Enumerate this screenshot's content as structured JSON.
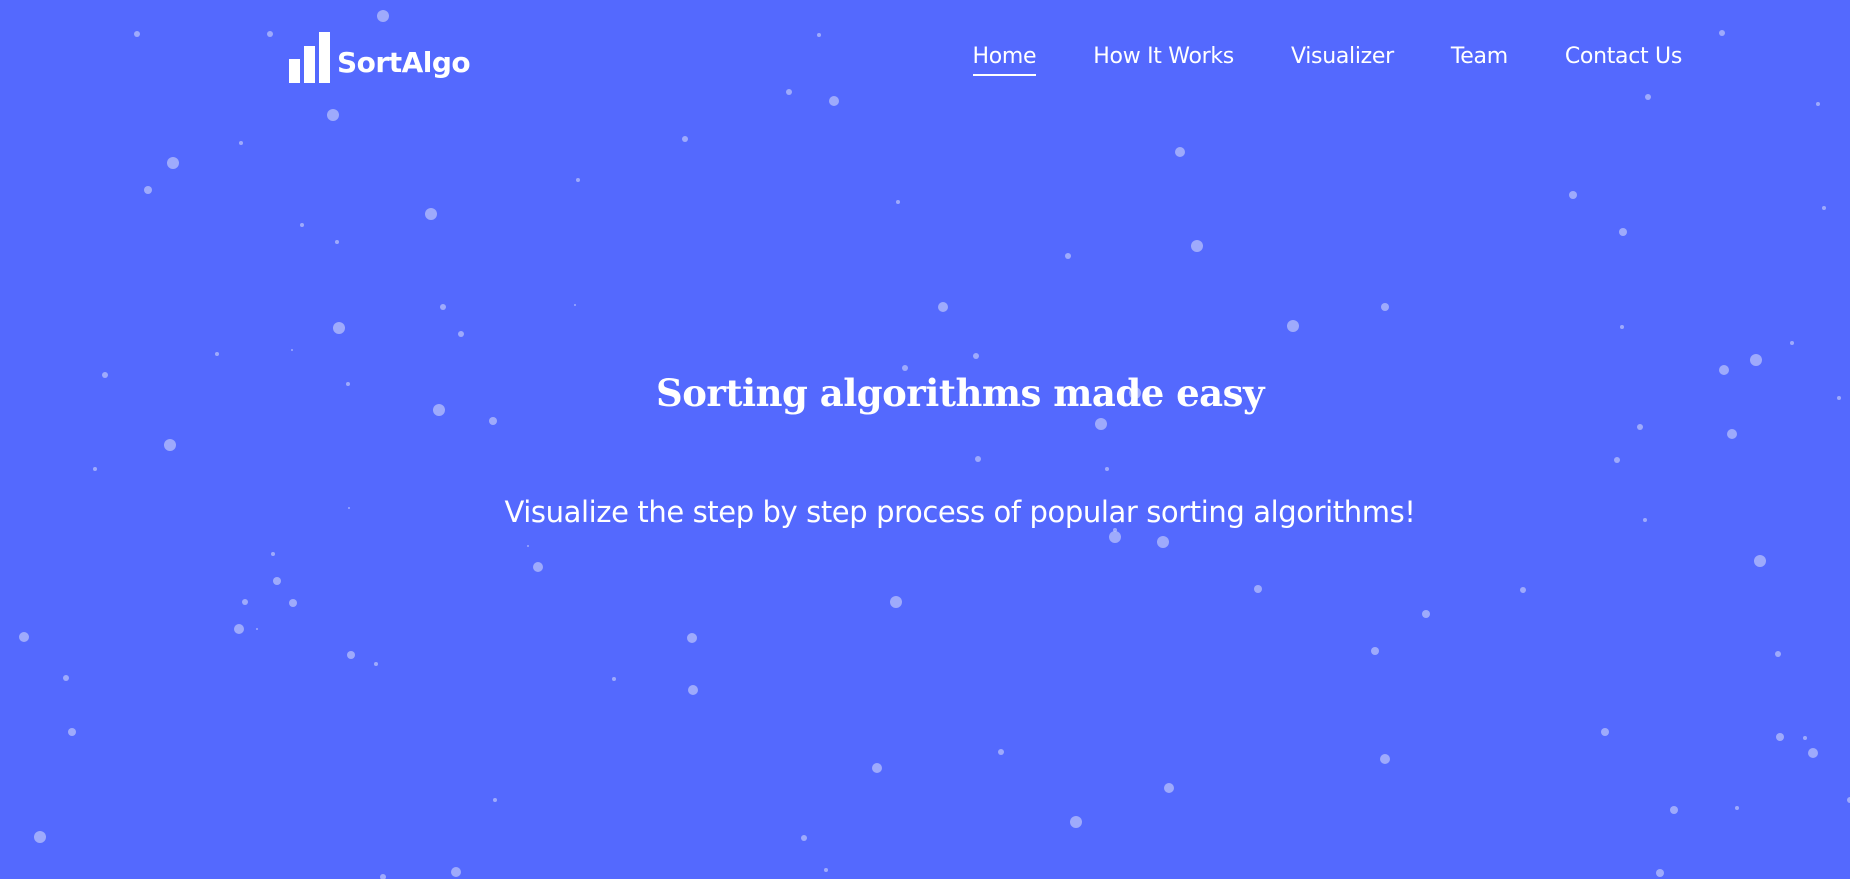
{
  "brand": {
    "name": "SortAlgo",
    "logo_icon": "bar-chart-icon"
  },
  "nav": {
    "items": [
      {
        "label": "Home",
        "active": true
      },
      {
        "label": "How It Works",
        "active": false
      },
      {
        "label": "Visualizer",
        "active": false
      },
      {
        "label": "Team",
        "active": false
      },
      {
        "label": "Contact Us",
        "active": false
      }
    ]
  },
  "hero": {
    "title": "Sorting algorithms made easy",
    "subtitle": "Visualize the step by step process of popular sorting algorithms!"
  },
  "colors": {
    "background": "#5469fe",
    "text": "#ffffff",
    "particle": "#b7c0fb"
  }
}
